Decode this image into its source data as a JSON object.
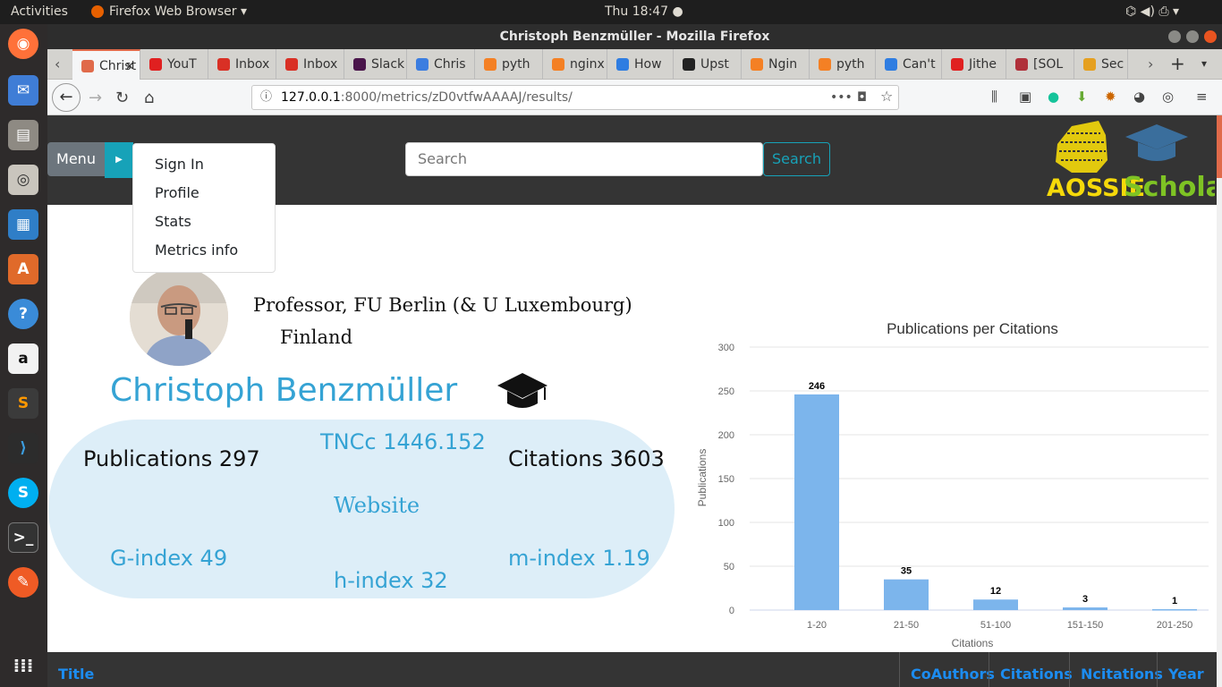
{
  "topbar": {
    "activities": "Activities",
    "app": "Firefox Web Browser ▾",
    "clock": "Thu 18:47 ●",
    "indicators": "⌬ ◀) ⎙ ▾"
  },
  "window": {
    "title": "Christoph Benzmüller - Mozilla Firefox"
  },
  "tabs": [
    {
      "label": "Christ",
      "color": "#e06a4a"
    },
    {
      "label": "YouT",
      "color": "#e02020"
    },
    {
      "label": "Inbox",
      "color": "#d93025"
    },
    {
      "label": "Inbox",
      "color": "#d93025"
    },
    {
      "label": "Slack",
      "color": "#4a154b"
    },
    {
      "label": "Chris",
      "color": "#3b7de0"
    },
    {
      "label": "pyth",
      "color": "#f48024"
    },
    {
      "label": "nginx",
      "color": "#f48024"
    },
    {
      "label": "How",
      "color": "#2f7de1"
    },
    {
      "label": "Upst",
      "color": "#222222"
    },
    {
      "label": "Ngin",
      "color": "#f48024"
    },
    {
      "label": "pyth",
      "color": "#f48024"
    },
    {
      "label": "Can't",
      "color": "#2f7de1"
    },
    {
      "label": "Jithe",
      "color": "#e02020"
    },
    {
      "label": "[SOL",
      "color": "#b0303a"
    },
    {
      "label": "Sec",
      "color": "#e5a020"
    }
  ],
  "url": {
    "host": "127.0.0.1",
    "rest": ":8000/metrics/zD0vtfwAAAAJ/results/"
  },
  "site": {
    "menu_label": "Menu",
    "search_placeholder": "Search",
    "search_button": "Search",
    "logo_text1": "AOSSIE",
    "logo_text2": "Scholar",
    "dropdown": [
      "Sign In",
      "Profile",
      "Stats",
      "Metrics info"
    ]
  },
  "profile": {
    "affiliation": "Professor, FU Berlin (& U Luxembourg)",
    "country": "Finland",
    "name": "Christoph Benzmüller",
    "publications": "Publications 297",
    "tncc": "TNCc 1446.152",
    "citations": "Citations 3603",
    "website": "Website",
    "gindex": "G-index 49",
    "hindex": "h-index 32",
    "mindex": "m-index 1.19"
  },
  "chart_data": {
    "type": "bar",
    "title": "Publications per Citations",
    "xlabel": "Citations",
    "ylabel": "Publications",
    "categories": [
      "1-20",
      "21-50",
      "51-100",
      "151-150",
      "201-250"
    ],
    "values": [
      246,
      35,
      12,
      3,
      1
    ],
    "ylim": [
      0,
      300
    ],
    "yticks": [
      0,
      50,
      100,
      150,
      200,
      250,
      300
    ],
    "grid": true,
    "color": "#7cb5ec"
  },
  "table": {
    "headers": [
      "Title",
      "CoAuthors",
      "Citations",
      "Ncitations",
      "Year"
    ]
  }
}
